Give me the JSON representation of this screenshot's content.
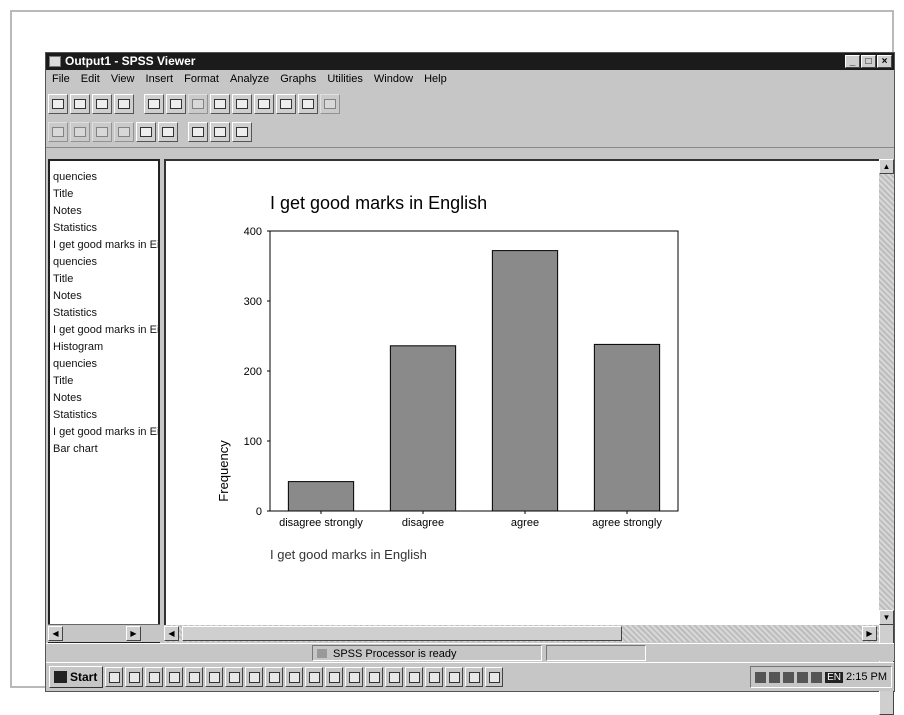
{
  "window": {
    "title": "Output1 - SPSS Viewer",
    "controls": [
      "_",
      "□",
      "×"
    ]
  },
  "menu": [
    "File",
    "Edit",
    "View",
    "Insert",
    "Format",
    "Analyze",
    "Graphs",
    "Utilities",
    "Window",
    "Help"
  ],
  "outline": {
    "items": [
      "quencies",
      "Title",
      "Notes",
      "Statistics",
      "I get good marks in Ei",
      "quencies",
      "Title",
      "Notes",
      "Statistics",
      "I get good marks in Ei",
      "Histogram",
      "quencies",
      "Title",
      "Notes",
      "Statistics",
      "I get good marks in Ei",
      "Bar chart"
    ]
  },
  "status": {
    "text": "SPSS Processor  is ready"
  },
  "taskbar": {
    "start": "Start",
    "clock": "2:15 PM",
    "lang": "EN"
  },
  "chart_data": {
    "type": "bar",
    "title": "I get good marks in English",
    "xlabel": "I get good marks in English",
    "ylabel": "Frequency",
    "categories": [
      "disagree strongly",
      "disagree",
      "agree",
      "agree strongly"
    ],
    "values": [
      42,
      236,
      372,
      238
    ],
    "ylim": [
      0,
      400
    ],
    "yticks": [
      0,
      100,
      200,
      300,
      400
    ],
    "bar_color": "#8a8a8a",
    "grid": false
  }
}
